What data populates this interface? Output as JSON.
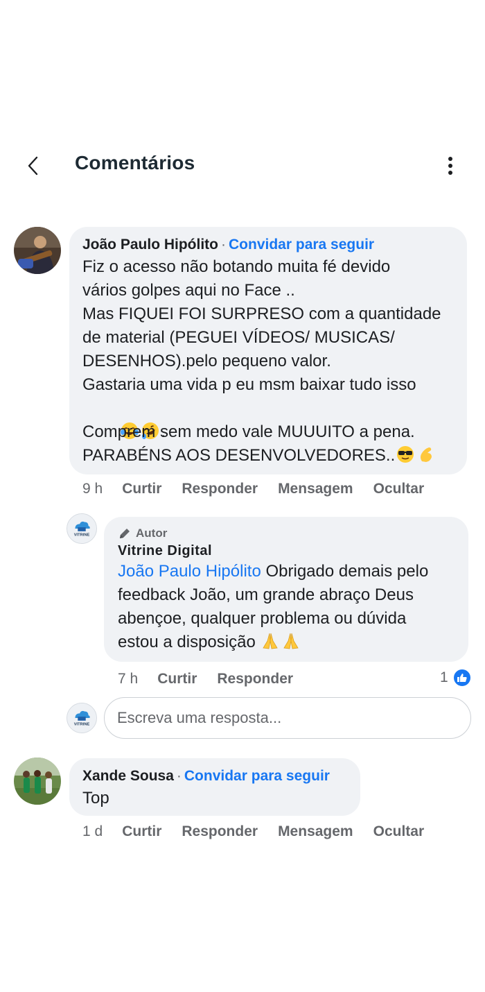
{
  "header": {
    "title": "Comentários"
  },
  "comments": [
    {
      "author": "João Paulo Hipólito",
      "follow": "Convidar para seguir",
      "lines": [
        "Fiz o acesso não botando muita fé devido",
        "vários golpes aqui no Face ..",
        "Mas FIQUEI FOI SURPRESO com a quantidade",
        "de material (PEGUEI VÍDEOS/ MUSICAS/",
        "DESENHOS).pelo pequeno valor.",
        "Gastaria uma vida p eu msm baixar tudo isso",
        "",
        "Comprem sem medo vale MUUUITO a pena.",
        "PARABÉNS AOS DESENVOLVEDORES.."
      ],
      "time": "9 h",
      "actions": [
        "Curtir",
        "Responder",
        "Mensagem",
        "Ocultar"
      ]
    },
    {
      "author": "Xande Sousa",
      "follow": "Convidar para seguir",
      "text": "Top",
      "time": "1 d",
      "actions": [
        "Curtir",
        "Responder",
        "Mensagem",
        "Ocultar"
      ]
    }
  ],
  "reply": {
    "badge": "Autor",
    "page_name": "Vitrine Digital",
    "mention": "João Paulo Hipólito",
    "lines": [
      " Obrigado demais pelo",
      "feedback João, um grande abraço Deus",
      "abençoe, qualquer problema ou dúvida",
      "estou a disposição "
    ],
    "time": "7 h",
    "actions": [
      "Curtir",
      "Responder"
    ],
    "like_count": "1",
    "avatar_label": "VITRINE"
  },
  "reply_input": {
    "placeholder": "Escreva uma resposta..."
  },
  "icons": {
    "back": "chevron-left-icon",
    "more": "more-vertical-icon",
    "pencil": "pencil-icon",
    "like": "thumbs-up-icon"
  },
  "colors": {
    "link": "#1877f2",
    "bubble": "#f0f2f5",
    "muted": "#65676b"
  }
}
